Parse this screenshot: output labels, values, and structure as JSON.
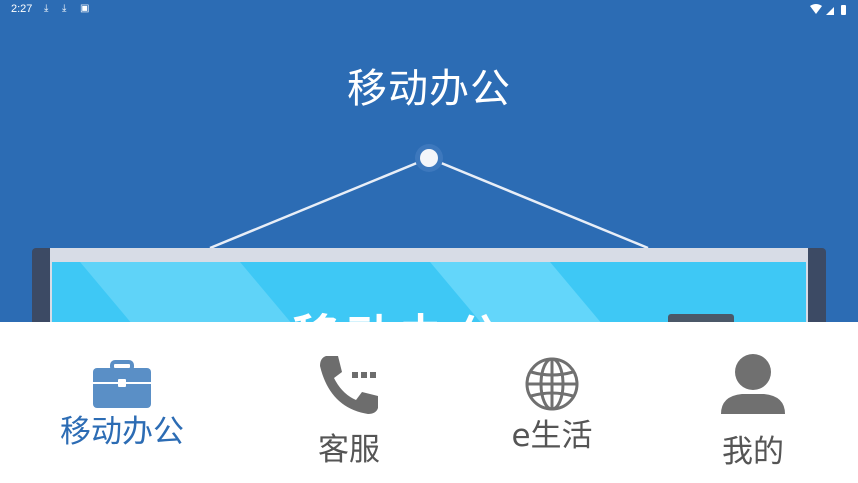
{
  "status_bar": {
    "time": "2:27"
  },
  "header": {
    "title": "移动办公"
  },
  "banner": {
    "board_text": "移动办公"
  },
  "bottom_nav": {
    "items": [
      {
        "label": "移动办公",
        "icon": "briefcase-icon",
        "active": true
      },
      {
        "label": "客服",
        "icon": "phone-icon",
        "active": false
      },
      {
        "label": "e生活",
        "icon": "globe-icon",
        "active": false
      },
      {
        "label": "我的",
        "icon": "person-icon",
        "active": false
      }
    ]
  },
  "colors": {
    "primary_blue": "#2c6cb4",
    "board_cyan": "#3ec8f5",
    "icon_gray": "#707070",
    "active_icon_blue": "#5a8fc6"
  }
}
